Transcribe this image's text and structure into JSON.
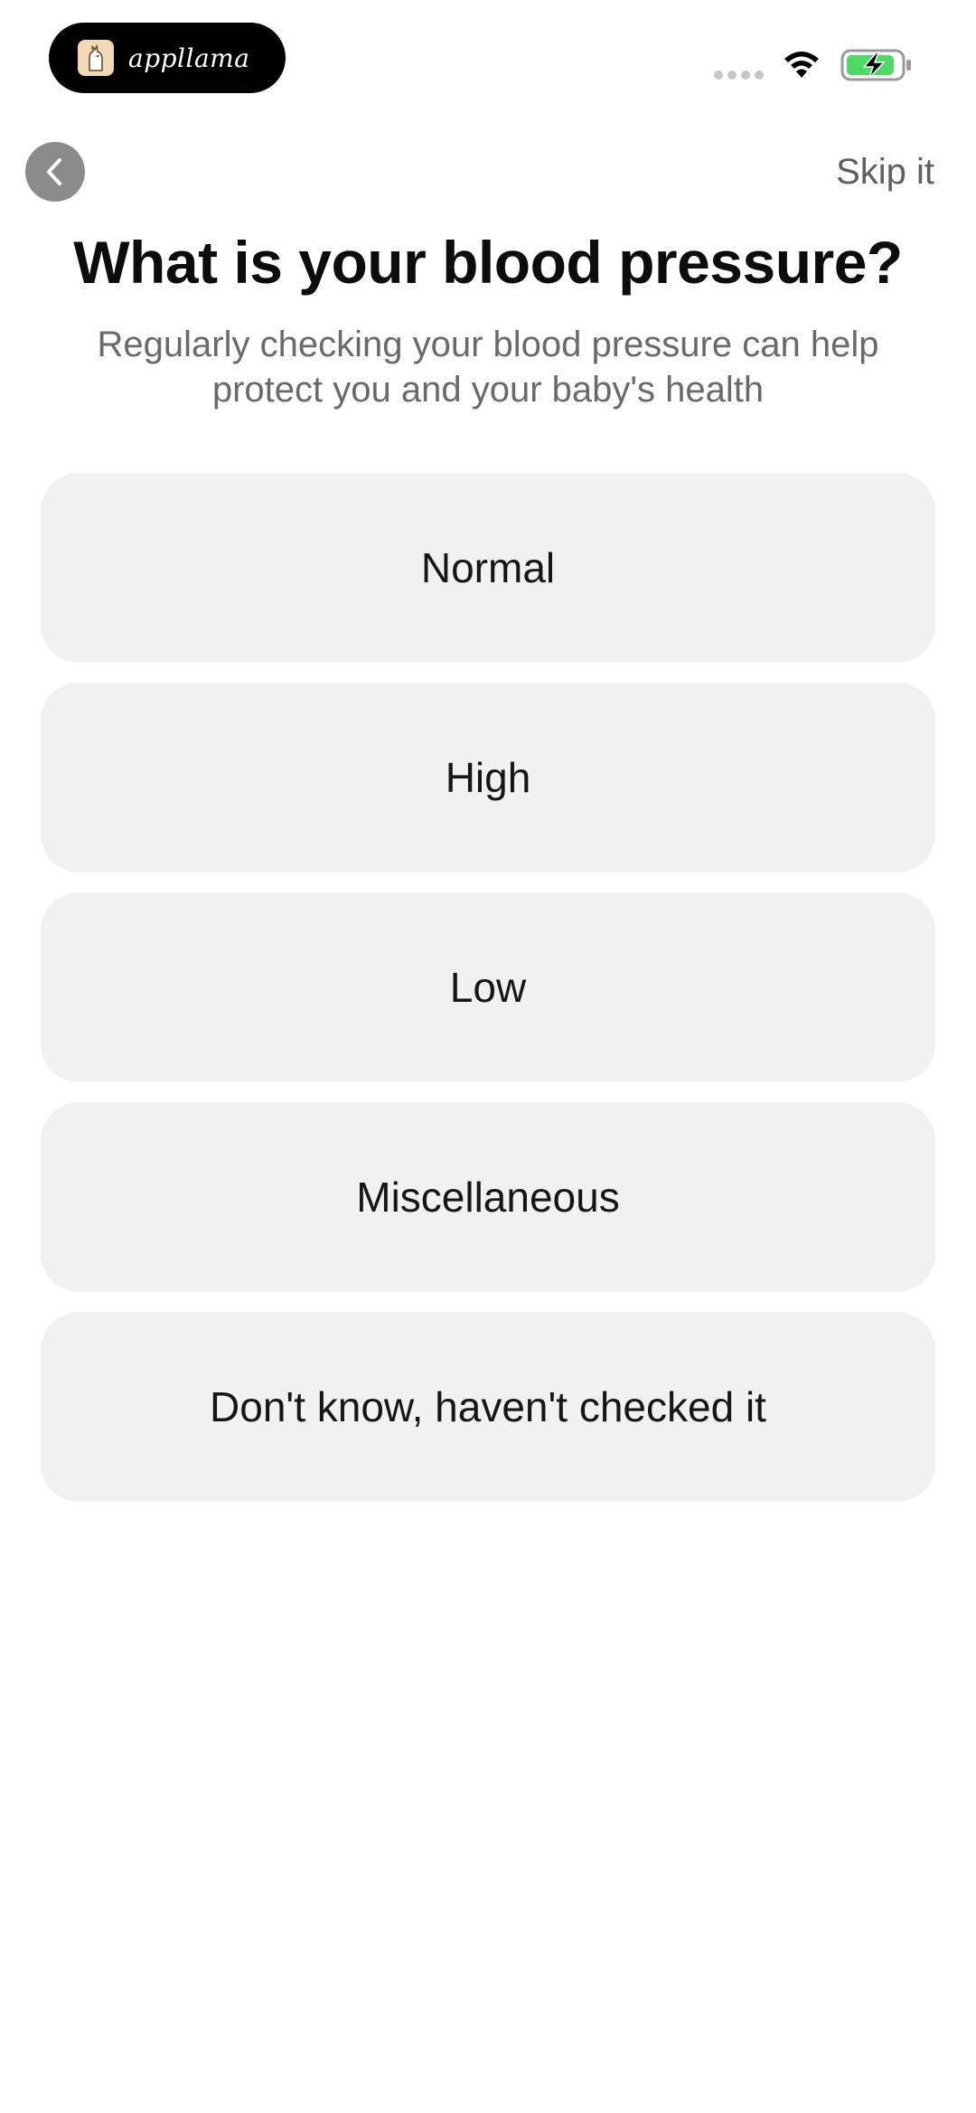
{
  "status_bar": {
    "brand_name": "appllama",
    "battery_color": "#4cd964",
    "icons": [
      "signal-dots-icon",
      "wifi-icon",
      "battery-charging-icon"
    ]
  },
  "header": {
    "back_icon": "chevron-left-icon",
    "skip_label": "Skip it"
  },
  "question": {
    "title": "What is your blood pressure?",
    "subtitle": "Regularly checking your blood pressure can help protect you and your baby's health"
  },
  "options": [
    {
      "label": "Normal"
    },
    {
      "label": "High"
    },
    {
      "label": "Low"
    },
    {
      "label": "Miscellaneous"
    },
    {
      "label": "Don't know, haven't checked it"
    }
  ]
}
